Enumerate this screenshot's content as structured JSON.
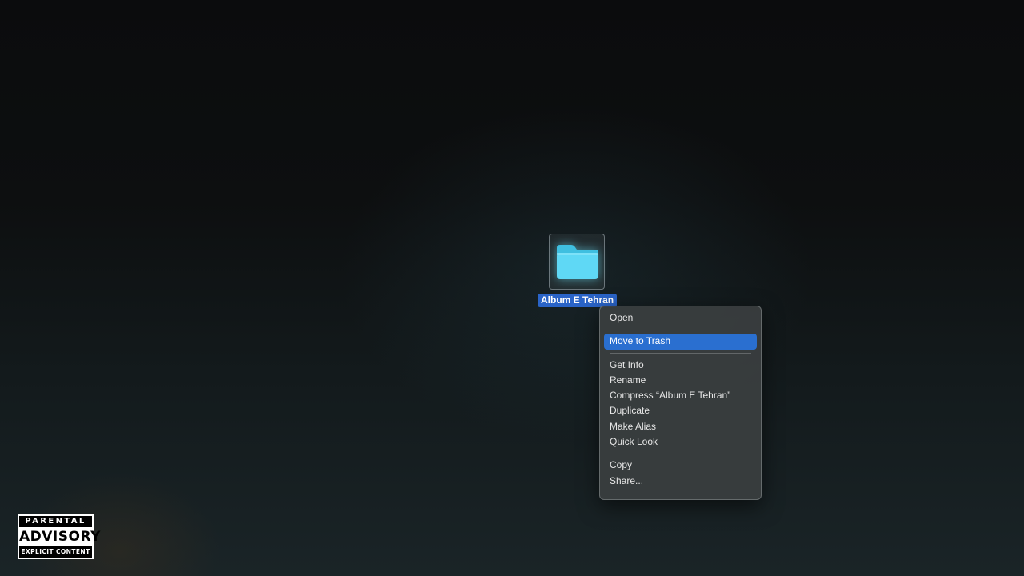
{
  "desktop": {
    "folder": {
      "name": "Album E Tehran",
      "icon": "folder-icon",
      "selected": true,
      "colors": {
        "folder_body": "#5fd8f5",
        "folder_tab": "#3fbfe0",
        "selection": "#2a64c8"
      }
    }
  },
  "context_menu": {
    "highlight_color": "#2a6fd0",
    "groups": [
      [
        {
          "label": "Open"
        }
      ],
      [
        {
          "label": "Move to Trash",
          "highlighted": true
        }
      ],
      [
        {
          "label": "Get Info"
        },
        {
          "label": "Rename"
        },
        {
          "label": "Compress “Album E Tehran”"
        },
        {
          "label": "Duplicate"
        },
        {
          "label": "Make Alias"
        },
        {
          "label": "Quick Look"
        }
      ],
      [
        {
          "label": "Copy"
        },
        {
          "label": "Share..."
        }
      ]
    ]
  },
  "advisory_badge": {
    "top": "PARENTAL",
    "middle": "ADVISORY",
    "bottom": "EXPLICIT CONTENT"
  }
}
